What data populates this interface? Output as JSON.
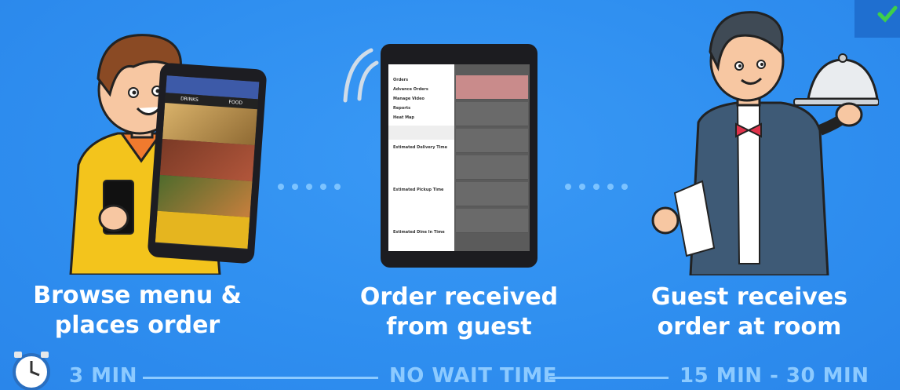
{
  "steps": [
    {
      "caption_line1": "Browse menu &",
      "caption_line2": "places order",
      "time": "3 MIN"
    },
    {
      "caption_line1": "Order received",
      "caption_line2": "from guest",
      "time": "NO WAIT TIME"
    },
    {
      "caption_line1": "Guest receives",
      "caption_line2": "order at room",
      "time": "15 MIN - 30 MIN"
    }
  ],
  "tablet_menu": [
    "Orders",
    "Advance Orders",
    "Manage Video",
    "Reports",
    "Heat Map"
  ],
  "tablet_sections": [
    "Estimated Delivery Time",
    "Estimated Pickup Time",
    "Estimated Dine In Time"
  ],
  "phone_tabs": [
    "DRINKS",
    "FOOD"
  ],
  "icons": [
    "clock-icon",
    "checkmark-icon",
    "signal-icon"
  ],
  "colors": {
    "background": "#2f8ff0",
    "accent": "#8ccaff",
    "check": "#3ecf4a"
  }
}
